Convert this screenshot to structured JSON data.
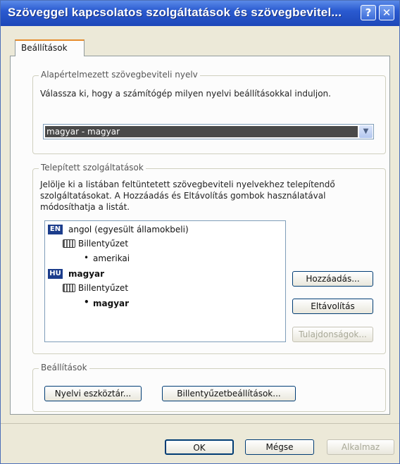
{
  "window": {
    "title": "Szöveggel kapcsolatos szolgáltatások és szövegbevitel...",
    "help_glyph": "?",
    "close_glyph": "✕"
  },
  "tab": {
    "label": "Beállítások"
  },
  "default_lang": {
    "legend": "Alapértelmezett szövegbeviteli nyelv",
    "description": "Válassza ki, hogy a számítógép milyen nyelvi beállításokkal induljon.",
    "selected": "magyar - magyar"
  },
  "installed": {
    "legend": "Telepített szolgáltatások",
    "description_lines": [
      "Jelölje ki a listában feltüntetett szövegbeviteli nyelvekhez telepítendő",
      "szolgáltatásokat. A Hozzáadás és Eltávolítás gombok használatával",
      "módosíthatja a listát."
    ],
    "tree": [
      {
        "badge": "EN",
        "language": "angol (egyesült államokbeli)",
        "category": "Billentyűzet",
        "layout": "amerikai"
      },
      {
        "badge": "HU",
        "language": "magyar",
        "category": "Billentyűzet",
        "layout": "magyar"
      }
    ],
    "buttons": {
      "add": "Hozzáadás...",
      "remove": "Eltávolítás",
      "properties": "Tulajdonságok..."
    }
  },
  "settings": {
    "legend": "Beállítások",
    "language_bar": "Nyelvi eszköztár...",
    "key_settings": "Billentyűzetbeállítások..."
  },
  "footer": {
    "ok": "OK",
    "cancel": "Mégse",
    "apply": "Alkalmaz"
  },
  "colors": {
    "title_bar": "#2a5ad0",
    "tab_highlight": "#e68b2c",
    "selection": "#4a4a4a",
    "lang_badge": "#1c3d8c"
  },
  "icons": {
    "language_badge": "language-badge-icon",
    "keyboard": "keyboard-icon",
    "dropdown": "chevron-down-icon"
  }
}
